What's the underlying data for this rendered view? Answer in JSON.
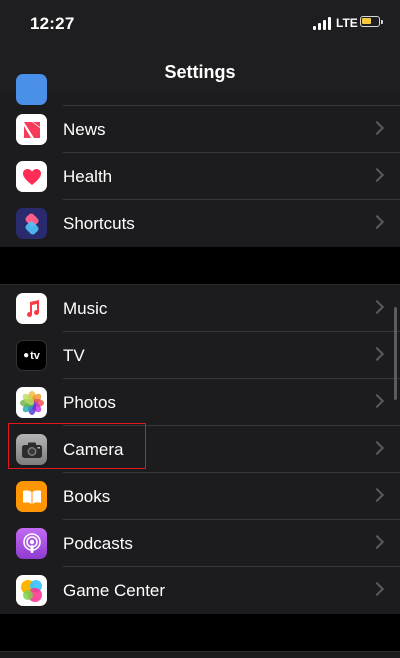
{
  "status_bar": {
    "time": "12:27",
    "network": "LTE",
    "battery_state": "charging",
    "battery_color": "#f5c842"
  },
  "nav": {
    "title": "Settings"
  },
  "group1": [
    {
      "label": "News",
      "icon": "news-icon",
      "color": "#ffffff"
    },
    {
      "label": "Health",
      "icon": "health-icon",
      "color": "#ffffff"
    },
    {
      "label": "Shortcuts",
      "icon": "shortcuts-icon",
      "color": "#2a2a6e"
    }
  ],
  "group2": [
    {
      "label": "Music",
      "icon": "music-icon",
      "color": "#ffffff"
    },
    {
      "label": "TV",
      "icon": "tv-icon",
      "color": "#000000"
    },
    {
      "label": "Photos",
      "icon": "photos-icon",
      "color": "#ffffff"
    },
    {
      "label": "Camera",
      "icon": "camera-icon",
      "color": "#9a9a9a"
    },
    {
      "label": "Books",
      "icon": "books-icon",
      "color": "#ff9500"
    },
    {
      "label": "Podcasts",
      "icon": "podcasts-icon",
      "color": "#9c4fe0"
    },
    {
      "label": "Game Center",
      "icon": "game-center-icon",
      "color": "#ffffff"
    }
  ],
  "tv_icon_text": "tv",
  "highlight_color": "#e0171d"
}
